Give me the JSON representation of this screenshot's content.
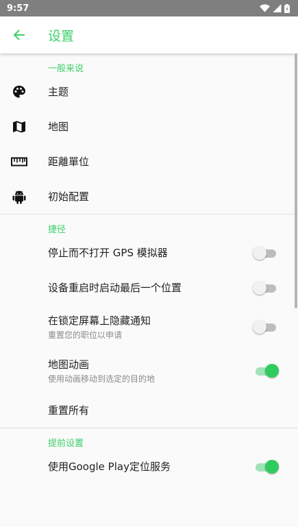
{
  "status_bar": {
    "time": "9:57"
  },
  "app_bar": {
    "title": "设置"
  },
  "sections": {
    "general": {
      "header": "一般来说",
      "items": [
        "主题",
        "地图",
        "距離單位",
        "初始配置"
      ]
    },
    "shortcuts": {
      "header": "捷径",
      "items": [
        {
          "label": "停止而不打开 GPS 模拟器",
          "sub": "",
          "on": false
        },
        {
          "label": "设备重启时启动最后一个位置",
          "sub": "",
          "on": false
        },
        {
          "label": "在锁定屏幕上隐藏通知",
          "sub": "重置您的职位以申请",
          "on": false
        },
        {
          "label": "地图动画",
          "sub": "使用动画移动到选定的目的地",
          "on": true
        }
      ],
      "reset_all": "重置所有"
    },
    "advanced": {
      "header": "提前设置",
      "items": [
        {
          "label": "使用Google Play定位服务",
          "on": true
        }
      ]
    }
  },
  "colors": {
    "accent": "#3ecf6a",
    "switch_on": "#2ecc5e",
    "status_bar": "#7f7f7f"
  },
  "icons": [
    "back-arrow-icon",
    "wifi-icon",
    "signal-icon",
    "battery-icon",
    "palette-icon",
    "map-icon",
    "ruler-icon",
    "android-icon"
  ]
}
